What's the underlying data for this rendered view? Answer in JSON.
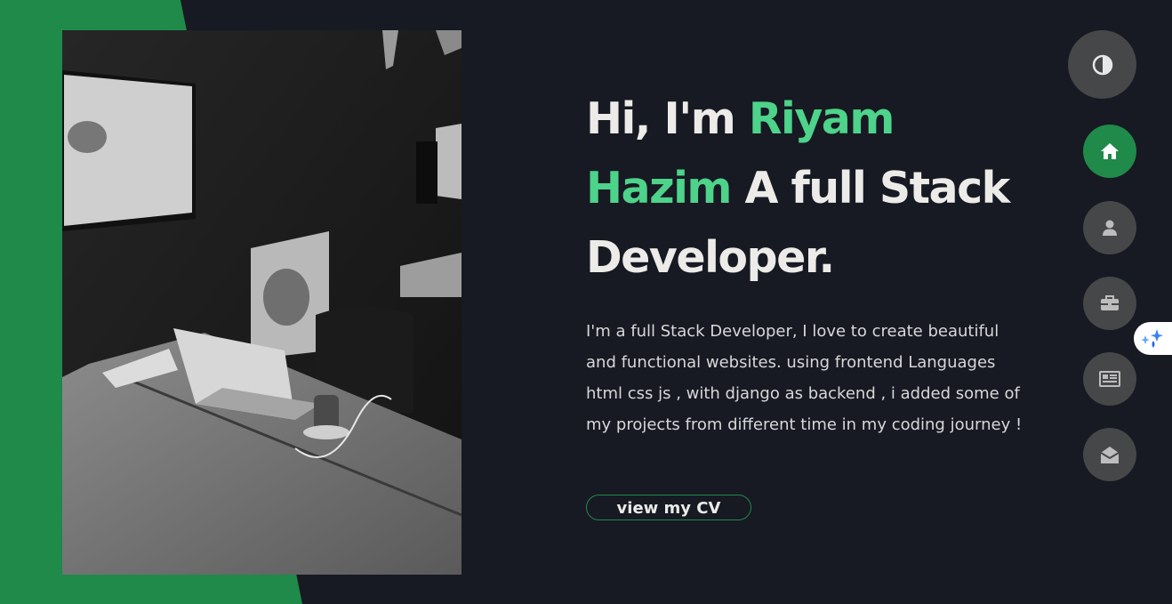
{
  "colors": {
    "background": "#171923",
    "accent_green": "#1f8a49",
    "name_green": "#4dd38a",
    "heading_text": "#ecebe8",
    "body_text": "#d8d8d8",
    "nav_button": "#454748"
  },
  "intro": {
    "greeting": "Hi, I'm ",
    "name_first": "Riyam",
    "name_last": "Hazim",
    "role": " A full Stack Developer.",
    "description": "I'm a full Stack Developer, I love to create beautiful and functional websites. using frontend Languages html css js , with django as backend , i added some of my projects from different time in my coding journey !",
    "cv_button_label": "view my CV"
  },
  "photo": {
    "icon": "black-and-white-photo-desk-laptop"
  },
  "controls": {
    "theme_toggle_icon": "contrast-icon",
    "nav": [
      {
        "id": "home",
        "icon": "home-icon",
        "active": true
      },
      {
        "id": "about",
        "icon": "user-icon",
        "active": false
      },
      {
        "id": "portfolio",
        "icon": "briefcase-icon",
        "active": false
      },
      {
        "id": "blogs",
        "icon": "newspaper-icon",
        "active": false
      },
      {
        "id": "contact",
        "icon": "envelope-open-icon",
        "active": false
      }
    ],
    "extension_icon": "sparkle-drops-icon"
  }
}
